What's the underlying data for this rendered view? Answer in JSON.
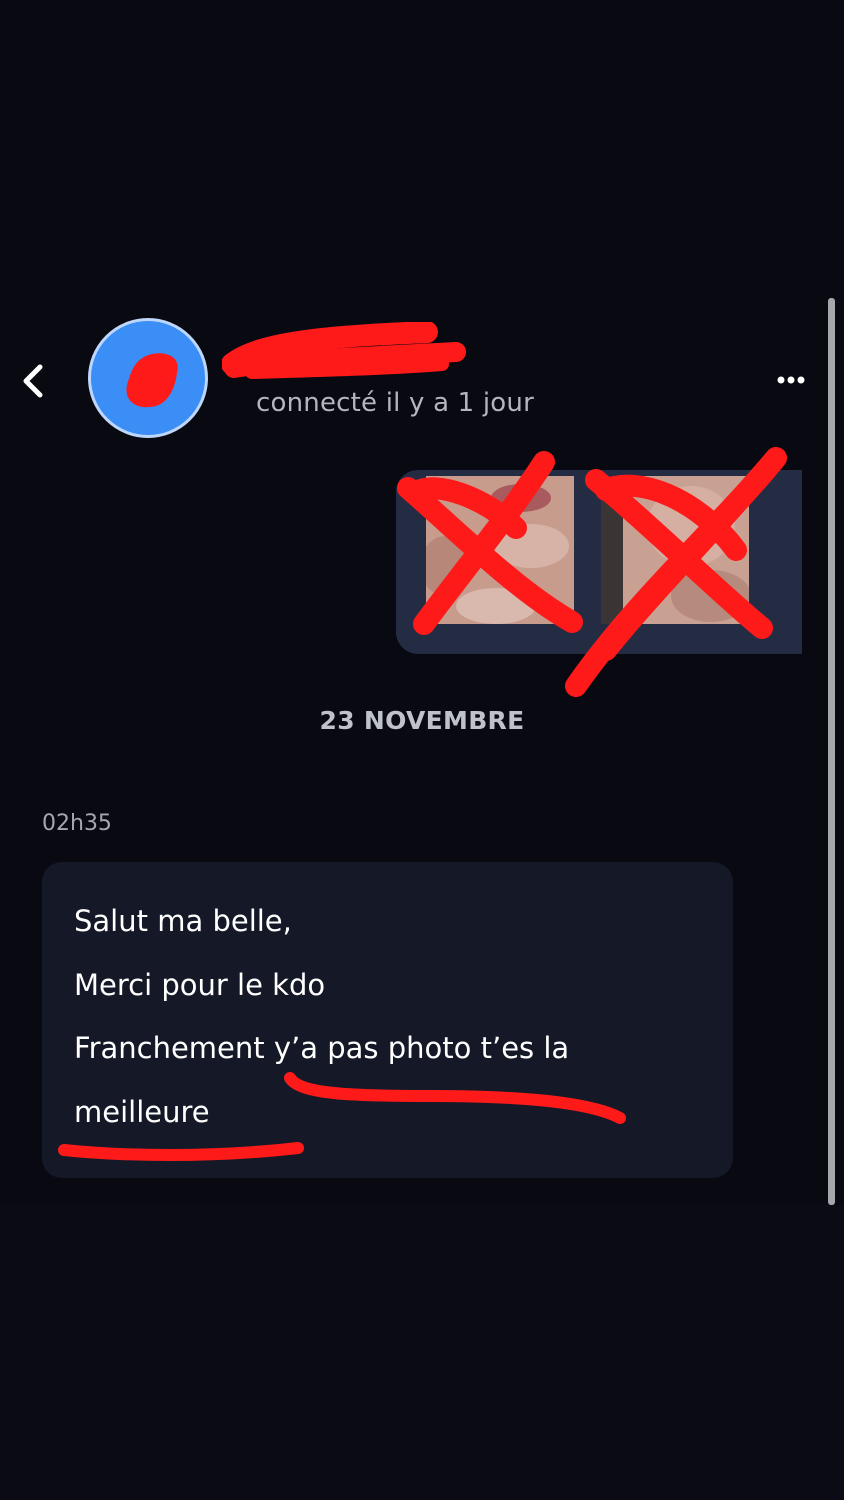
{
  "header": {
    "back_icon": "chevron-left-icon",
    "contact_status": "connecté il y a 1 jour",
    "more_icon": "more-dots-icon"
  },
  "colors": {
    "background": "#080911",
    "avatar_ring": "#3a8ef5",
    "incoming_bubble": "#151927",
    "outgoing_bubble": "#242c44",
    "redaction": "#ff1a1a"
  },
  "conversation": {
    "date_separator": "23 NOVEMBRE",
    "message": {
      "time": "02h35",
      "lines": [
        "Salut ma belle,",
        "Merci pour le kdo",
        "Franchement y’a pas photo t’es la",
        "meilleure"
      ]
    }
  }
}
